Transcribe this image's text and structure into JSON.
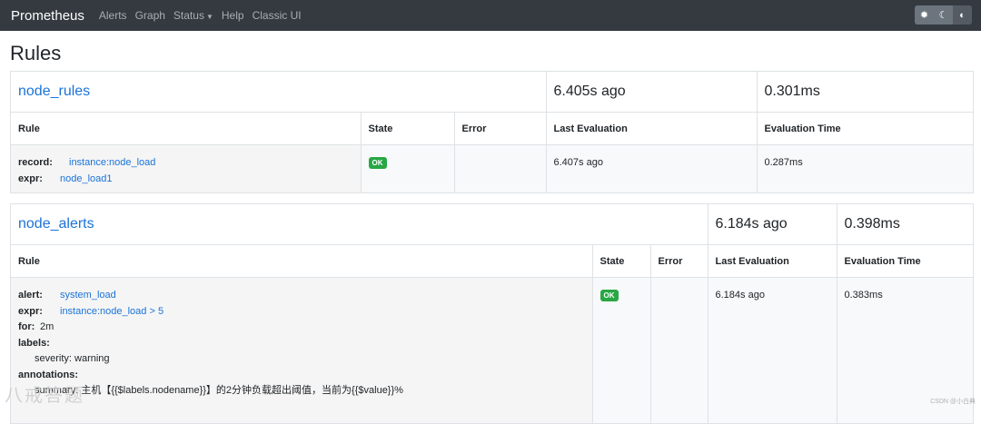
{
  "navbar": {
    "brand": "Prometheus",
    "links": [
      "Alerts",
      "Graph",
      "Status",
      "Help",
      "Classic UI"
    ],
    "theme_icons": [
      "sun-icon",
      "moon-icon",
      "contrast-icon"
    ]
  },
  "page_title": "Rules",
  "columns": {
    "rule": "Rule",
    "state": "State",
    "error": "Error",
    "last_eval": "Last Evaluation",
    "eval_time": "Evaluation Time"
  },
  "groups": [
    {
      "name": "node_rules",
      "last_eval": "6.405s ago",
      "eval_time": "0.301ms",
      "rule": {
        "record_key": "record:",
        "record_val": "instance:node_load",
        "expr_key": "expr:",
        "expr_val": "node_load1",
        "state": "OK",
        "error": "",
        "last_eval": "6.407s ago",
        "eval_time": "0.287ms"
      }
    },
    {
      "name": "node_alerts",
      "last_eval": "6.184s ago",
      "eval_time": "0.398ms",
      "rule": {
        "alert_key": "alert:",
        "alert_val": "system_load",
        "expr_key": "expr:",
        "expr_val": "instance:node_load > 5",
        "for_key": "for:",
        "for_val": "2m",
        "labels_key": "labels:",
        "labels_val": "severity: warning",
        "annotations_key": "annotations:",
        "annotations_val": "summary: 主机【{{$labels.nodename}}】的2分钟负载超出阈值，当前为{{$value}}%",
        "state": "OK",
        "error": "",
        "last_eval": "6.184s ago",
        "eval_time": "0.383ms"
      }
    }
  ],
  "watermark": {
    "left": "八戒答题",
    "right": "CSDN @小白典"
  }
}
